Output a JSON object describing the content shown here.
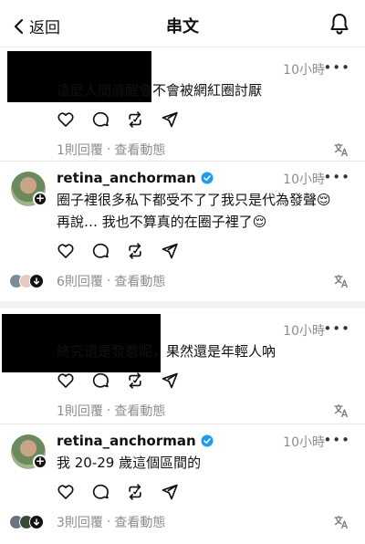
{
  "header": {
    "back_label": "返回",
    "title": "串文"
  },
  "threads": [
    {
      "time": "10小時",
      "text": "這麼人間清醒會不會被網紅圈討厭",
      "reply_count": "1則回覆",
      "view_activity": "查看動態"
    },
    {
      "username": "retina_anchorman",
      "time": "10小時",
      "text_line1": "圈子裡很多私下都受不了了我只是代為發聲😌",
      "text_line2": "再說… 我也不算真的在圈子裡了😌",
      "reply_count": "6則回覆",
      "view_activity": "查看動態"
    },
    {
      "time": "10小時",
      "text": "終究還是發惹呢，果然還是年輕人吶",
      "reply_count": "1則回覆",
      "view_activity": "查看動態"
    },
    {
      "username": "retina_anchorman",
      "time": "10小時",
      "text": "我 20-29 歲這個區間的",
      "reply_count": "3則回覆",
      "view_activity": "查看動態"
    }
  ],
  "separator": "·",
  "more_glyph": "•••"
}
